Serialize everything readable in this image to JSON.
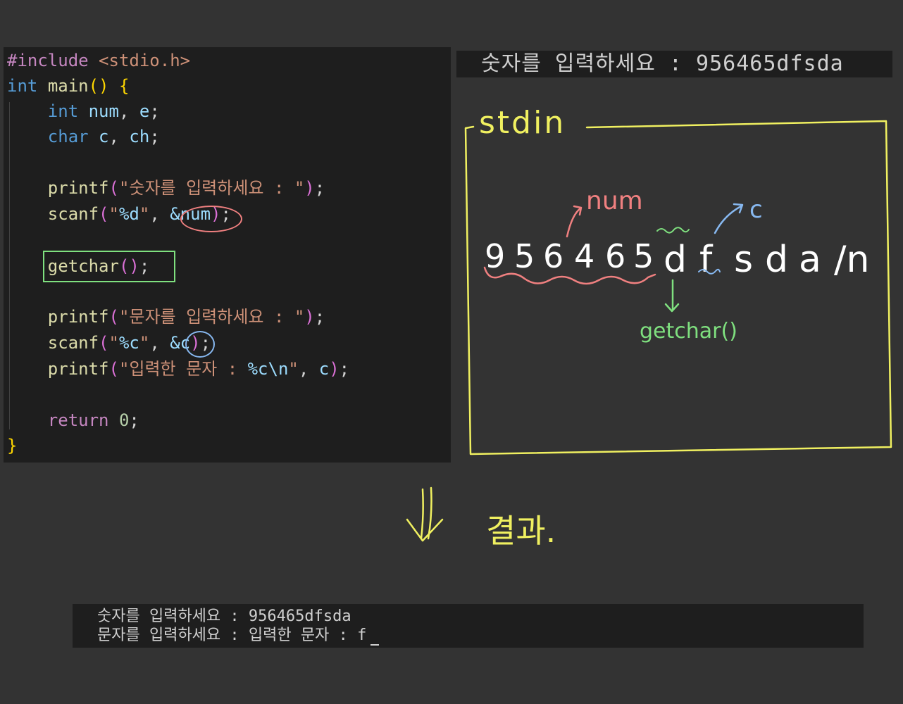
{
  "code": {
    "line1": {
      "pp": "#include",
      "header": "<stdio.h>"
    },
    "line2": {
      "type": "int",
      "fn": "main",
      "open": "()",
      "brace": "{"
    },
    "line3": {
      "type": "int",
      "vars": "num",
      "comma": ",",
      "var2": "e",
      "semi": ";"
    },
    "line4": {
      "type": "char",
      "vars": "c",
      "comma": ",",
      "var2": "ch",
      "semi": ";"
    },
    "line6": {
      "fn": "printf",
      "po": "(",
      "str": "\"숫자를 입력하세요 : \"",
      "pc": ")",
      "semi": ";"
    },
    "line7": {
      "fn": "scanf",
      "po": "(",
      "str1": "\"",
      "fmt": "%d",
      "str2": "\"",
      "comma": ", ",
      "arg": "&num",
      "pc": ")",
      "semi": ";"
    },
    "line9": {
      "fn": "getchar",
      "paren": "()",
      "semi": ";"
    },
    "line11": {
      "fn": "printf",
      "po": "(",
      "str": "\"문자를 입력하세요 : \"",
      "pc": ")",
      "semi": ";"
    },
    "line12": {
      "fn": "scanf",
      "po": "(",
      "str1": "\"",
      "fmt": "%c",
      "str2": "\"",
      "comma": ", ",
      "arg": "&c",
      "pc": ")",
      "semi": ";"
    },
    "line13": {
      "fn": "printf",
      "po": "(",
      "str1": "\"입력한 문자 : ",
      "fmt": "%c\\n",
      "str2": "\"",
      "comma": ", ",
      "arg": "c",
      "pc": ")",
      "semi": ";"
    },
    "line15": {
      "kw": "return",
      "val": "0",
      "semi": ";"
    },
    "line16": {
      "brace": "}"
    }
  },
  "console_top": {
    "text": "숫자를 입력하세요 : 956465dfsda"
  },
  "diagram": {
    "title": "stdin",
    "chars": [
      "9",
      "5",
      "6",
      "4",
      "6",
      "5",
      "d",
      "f",
      "s",
      "d",
      "a",
      "/n"
    ],
    "label_num": "num",
    "label_c": "c",
    "label_getchar": "getchar()",
    "result_label": "결과."
  },
  "console_bottom": {
    "line1": "숫자를 입력하세요 : 956465dfsda",
    "line2": "문자를 입력하세요 : 입력한 문자 : f"
  },
  "colors": {
    "num_annot": "#f08080",
    "c_annot": "#87b8f0",
    "getchar_annot": "#7fe07f",
    "stdin_box": "#f0f060"
  }
}
